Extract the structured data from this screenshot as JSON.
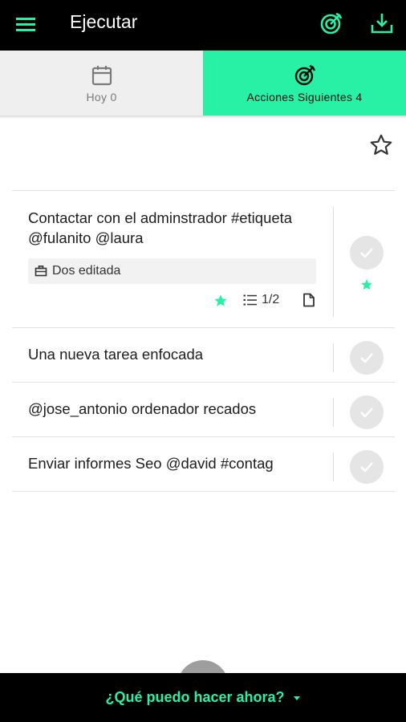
{
  "app": {
    "title": "Ejecutar",
    "icons": {
      "menu": "menu-icon",
      "target": "target-icon",
      "download": "download-icon"
    },
    "accent_color": "#28f1a6",
    "bar_color": "#000000"
  },
  "tabs": [
    {
      "label": "Hoy 0",
      "icon": "calendar-icon",
      "selected": false
    },
    {
      "label": "Acciones Siguientes 4",
      "icon": "target-arrow-icon",
      "selected": true
    }
  ],
  "filter": {
    "icon": "star-outline-icon"
  },
  "tasks": [
    {
      "text": "Contactar con el adminstrador #etiqueta @fulanito @laura",
      "project": "Dos editada",
      "project_icon": "briefcase-icon",
      "starred": true,
      "subtasks": "1/2",
      "has_note": true,
      "complete_icon": "check-icon"
    },
    {
      "text": "Una nueva tarea enfocada",
      "complete_icon": "check-icon"
    },
    {
      "text": "@jose_antonio ordenador recados",
      "complete_icon": "check-icon"
    },
    {
      "text": "Enviar informes Seo @david #contag",
      "complete_icon": "check-icon"
    }
  ],
  "bottom": {
    "label": "¿Qué puedo hacer ahora?",
    "icon": "caret-down-icon"
  }
}
